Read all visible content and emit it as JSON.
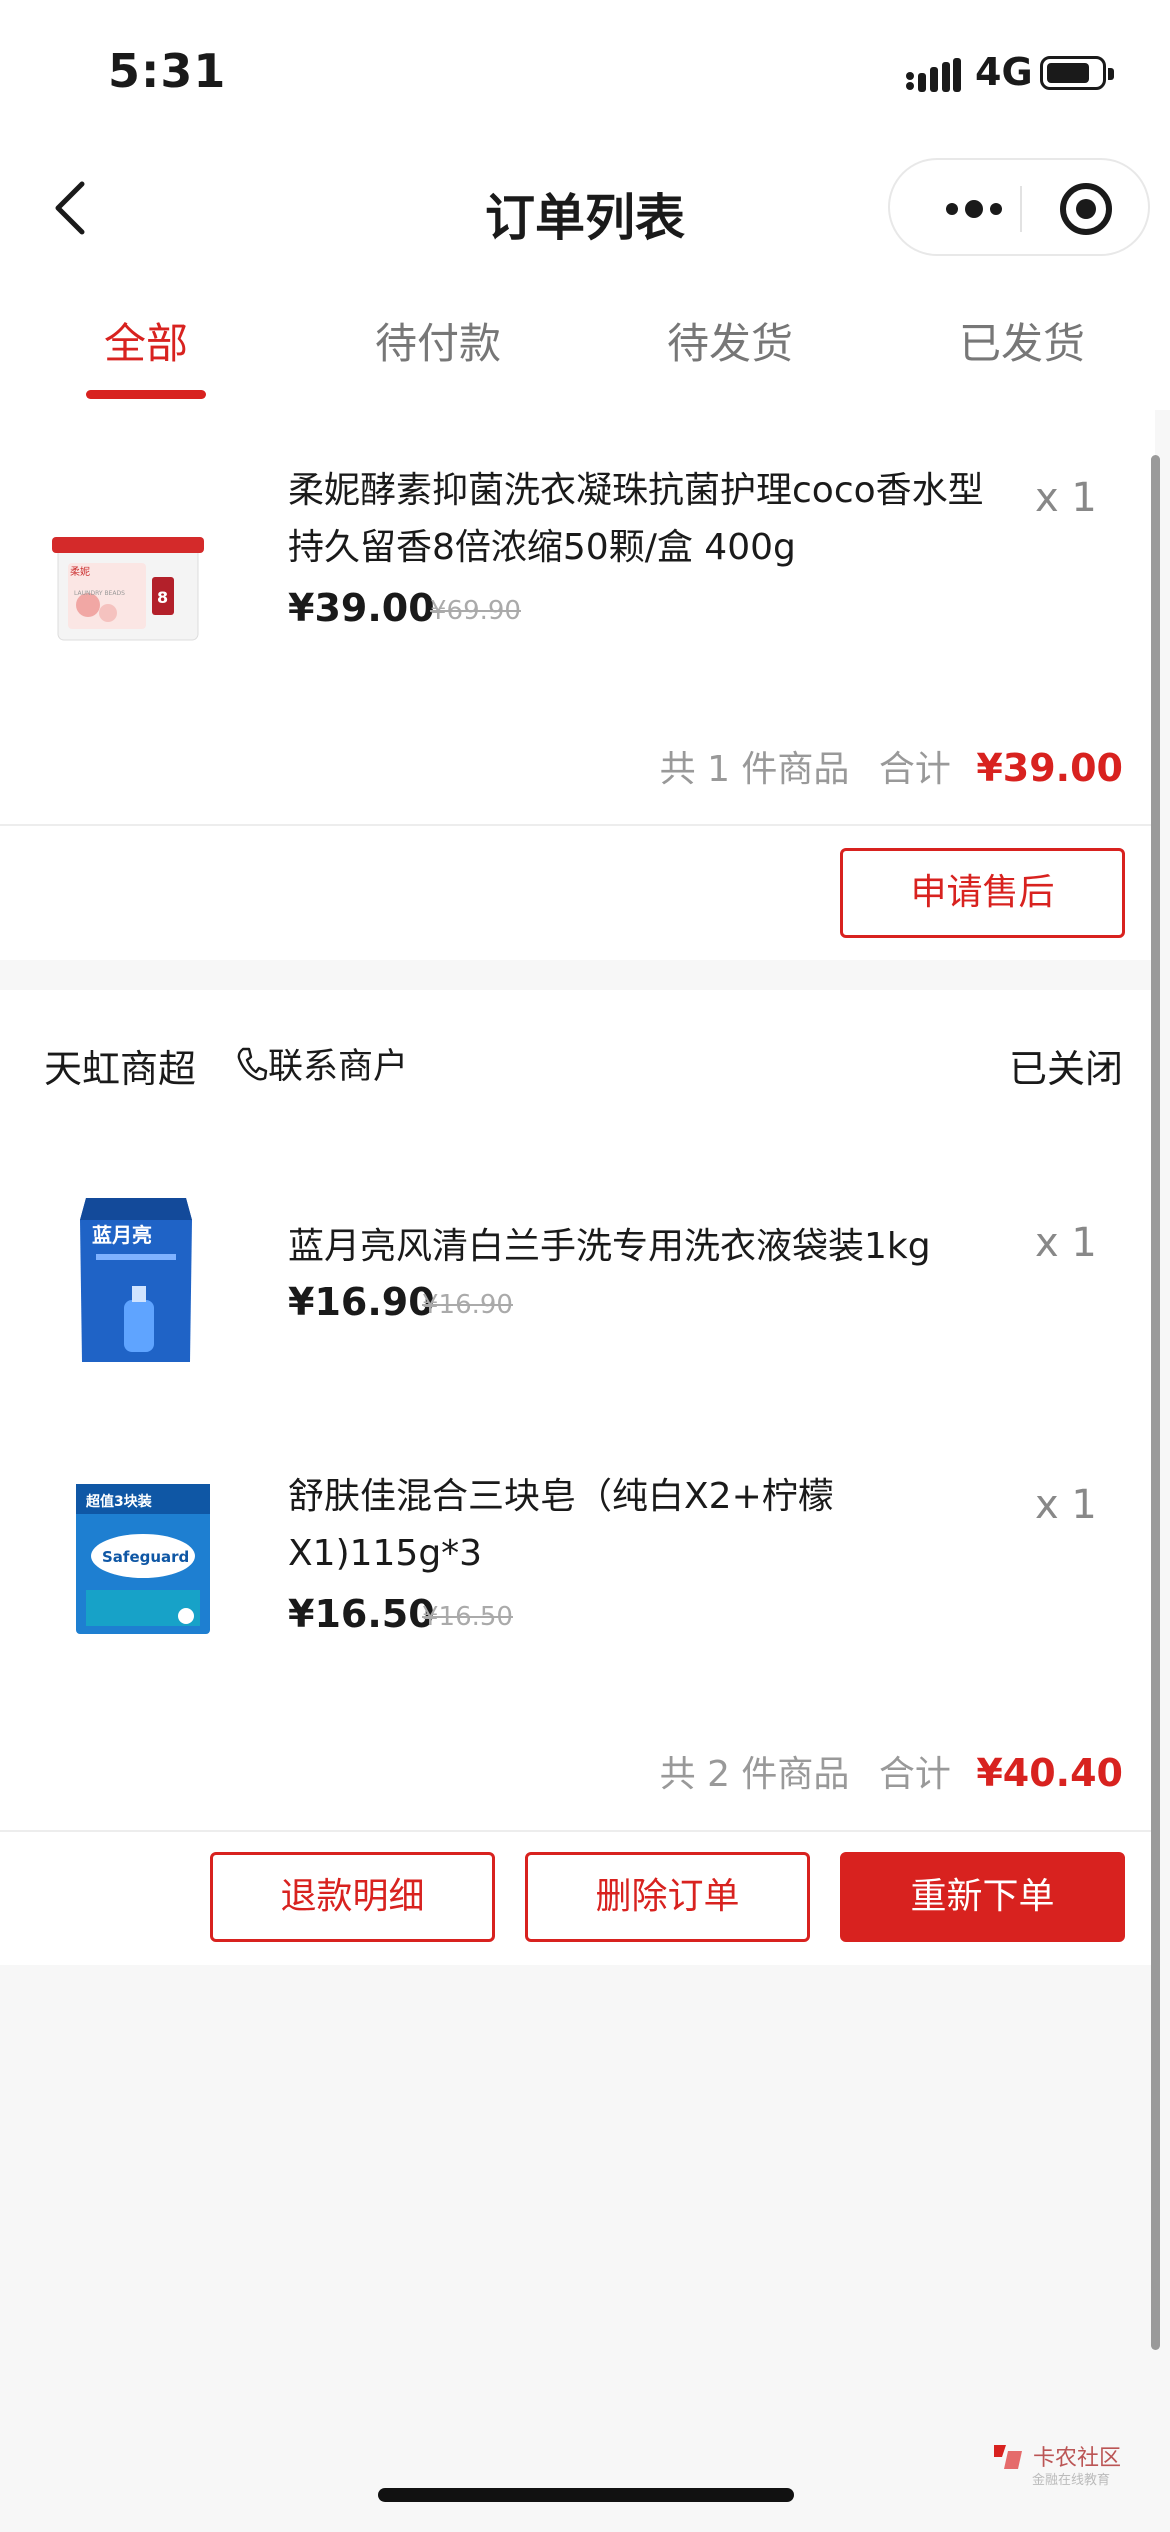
{
  "status": {
    "time": "5:31",
    "network": "4G"
  },
  "nav": {
    "title": "订单列表"
  },
  "tabs": [
    {
      "label": "全部",
      "active": true
    },
    {
      "label": "待付款"
    },
    {
      "label": "待发货"
    },
    {
      "label": "已发货"
    }
  ],
  "orders": [
    {
      "items": [
        {
          "name": "柔妮酵素抑菌洗衣凝珠抗菌护理coco香水型持久留香8倍浓缩50颗/盒 400g",
          "price": "¥39.00",
          "original_price": "¥69.90",
          "qty": "x 1"
        }
      ],
      "summary_count": "共 1 件商品",
      "summary_total_label": "合计",
      "summary_total": "¥39.00",
      "buttons": [
        "申请售后"
      ]
    },
    {
      "shop": "天虹商超",
      "contact": "联系商户",
      "status": "已关闭",
      "items": [
        {
          "name": "蓝月亮风清白兰手洗专用洗衣液袋装1kg",
          "price": "¥16.90",
          "original_price": "¥16.90",
          "qty": "x 1"
        },
        {
          "name": "舒肤佳混合三块皂（纯白X2+柠檬X1)115g*3",
          "price": "¥16.50",
          "original_price": "¥16.50",
          "qty": "x 1"
        }
      ],
      "summary_count": "共 2 件商品",
      "summary_total_label": "合计",
      "summary_total": "¥40.40",
      "buttons": [
        "退款明细",
        "删除订单",
        "重新下单"
      ]
    }
  ],
  "product_images": {
    "p1_brand": "柔妮",
    "p1_text": "LAUNDRY BEADS",
    "p1_badge": "8",
    "p2_brand": "蓝月亮",
    "p3_banner": "超值3块装",
    "p3_brand": "Safeguard"
  },
  "watermark": {
    "name": "卡农社区",
    "sub": "金融在线教育"
  },
  "colors": {
    "accent": "#d8221f",
    "muted": "#999999",
    "bg": "#f7f7f7"
  }
}
